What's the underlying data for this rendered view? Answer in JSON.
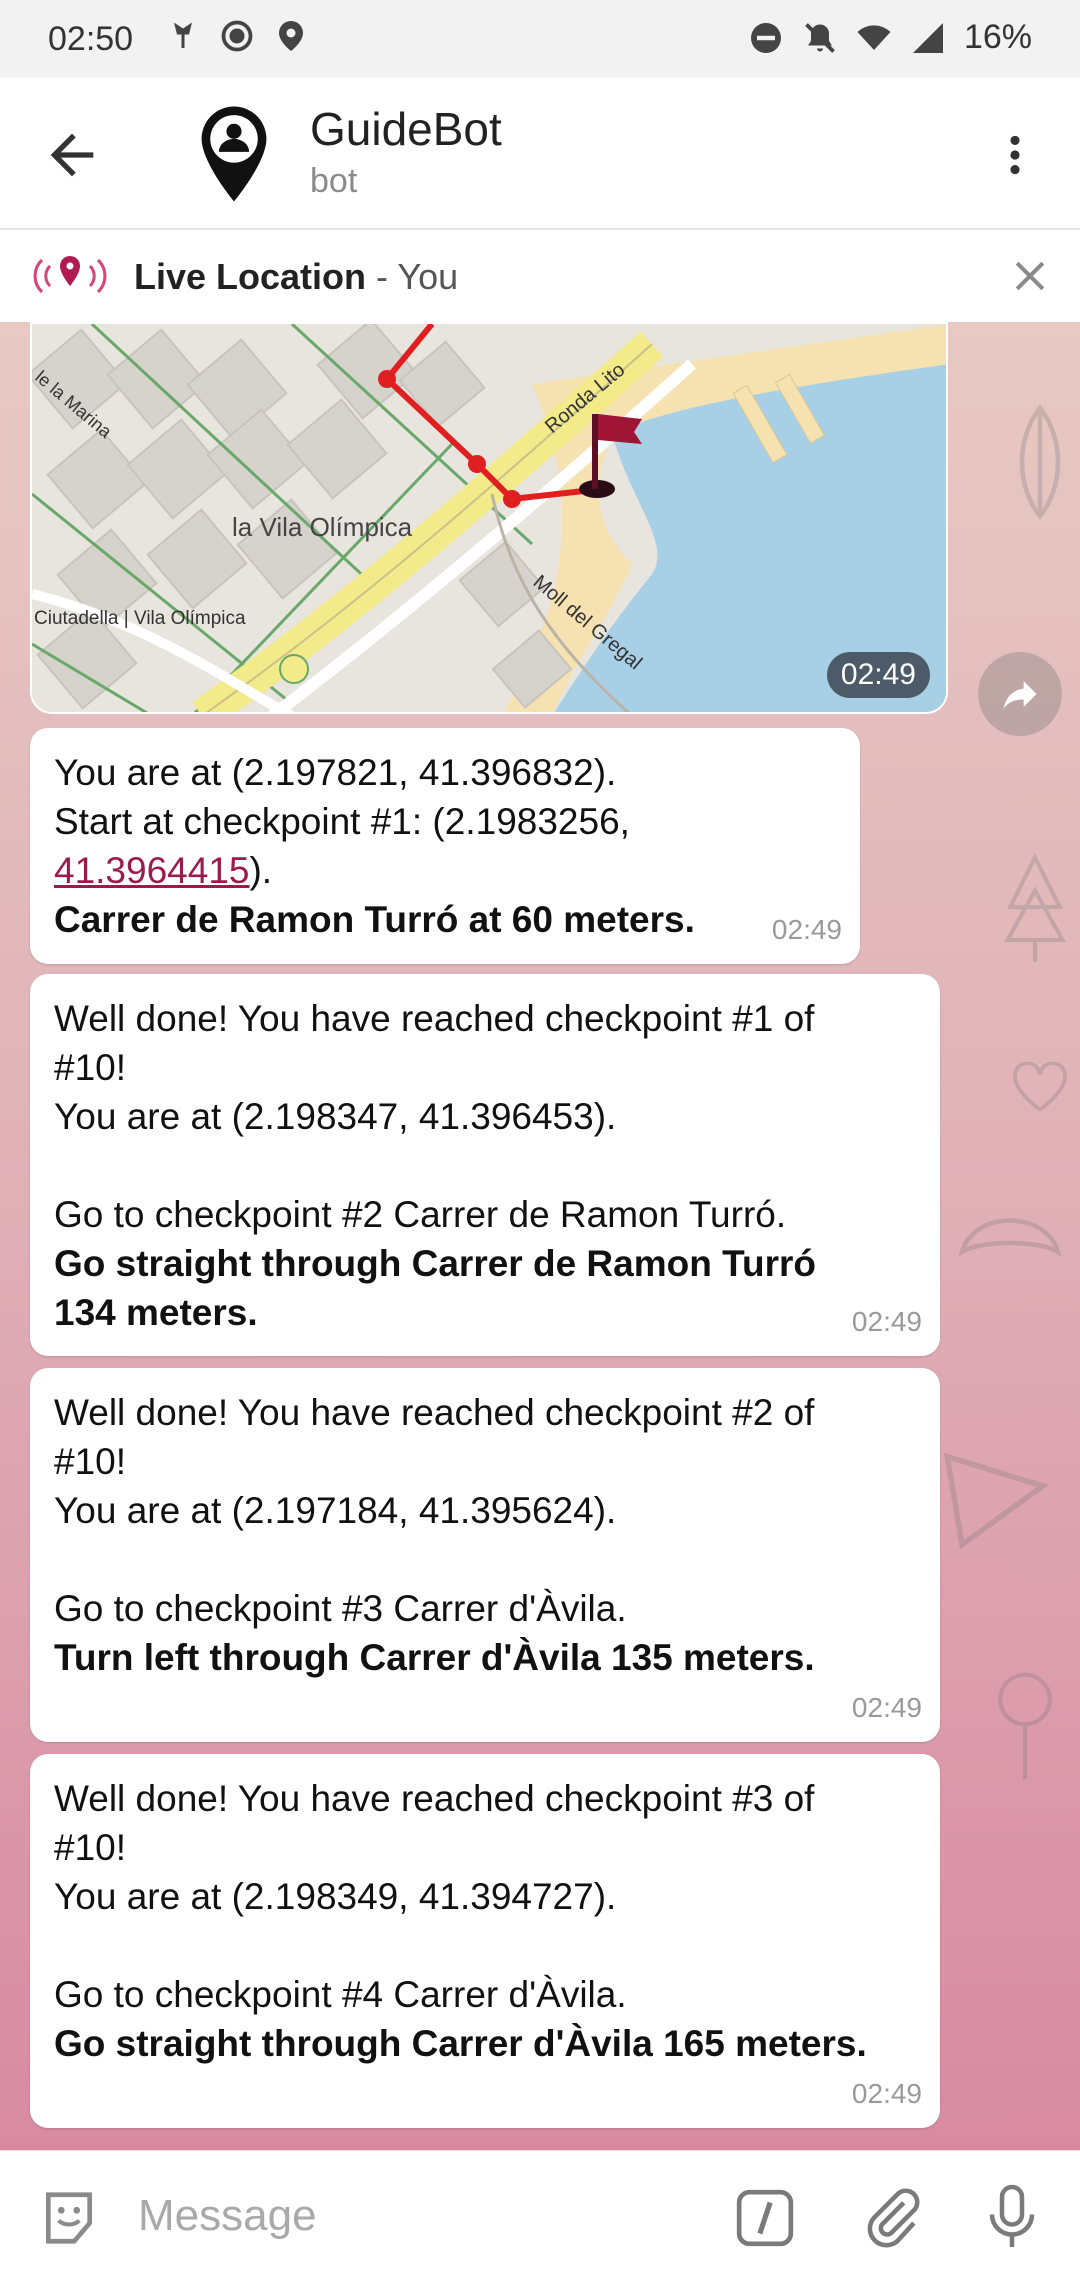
{
  "statusbar": {
    "time": "02:50",
    "battery": "16%"
  },
  "header": {
    "title": "GuideBot",
    "subtitle": "bot"
  },
  "live_location": {
    "label": "Live Location",
    "separator": " - ",
    "who": "You"
  },
  "map": {
    "time": "02:49",
    "labels": [
      "la Vila Olímpica",
      "Ciutadella | Vila Olímpica",
      "Ronda Lito",
      "Moll del Gregal",
      "le la Marina"
    ]
  },
  "messages": [
    {
      "lines": [
        {
          "text": "You are at (2.197821, 41.396832).",
          "bold": false
        },
        {
          "text": "Start at checkpoint #1: (2.1983256,",
          "bold": false
        },
        {
          "link": "41.3964415",
          "after": ").",
          "bold": false
        },
        {
          "text": "Carrer de Ramon Turró at 60 meters.",
          "bold": true
        }
      ],
      "time": "02:49"
    },
    {
      "lines": [
        {
          "text": "Well done! You have reached checkpoint #1 of",
          "bold": false
        },
        {
          "text": "#10!",
          "bold": false
        },
        {
          "text": "You are at (2.198347, 41.396453).",
          "bold": false
        },
        {
          "text": "",
          "bold": false
        },
        {
          "text": "Go to checkpoint #2 Carrer de Ramon Turró.",
          "bold": false
        },
        {
          "text": "Go straight through Carrer de Ramon Turró",
          "bold": true
        },
        {
          "text": "134 meters.",
          "bold": true
        }
      ],
      "time": "02:49"
    },
    {
      "lines": [
        {
          "text": "Well done! You have reached checkpoint #2 of",
          "bold": false
        },
        {
          "text": "#10!",
          "bold": false
        },
        {
          "text": "You are at (2.197184, 41.395624).",
          "bold": false
        },
        {
          "text": "",
          "bold": false
        },
        {
          "text": "Go to checkpoint #3 Carrer d'Àvila.",
          "bold": false
        },
        {
          "text": "Turn left through Carrer d'Àvila 135 meters.",
          "bold": true
        }
      ],
      "time": "02:49"
    },
    {
      "lines": [
        {
          "text": "Well done! You have reached checkpoint #3 of",
          "bold": false
        },
        {
          "text": "#10!",
          "bold": false
        },
        {
          "text": "You are at (2.198349, 41.394727).",
          "bold": false
        },
        {
          "text": "",
          "bold": false
        },
        {
          "text": "Go to checkpoint #4 Carrer d'Àvila.",
          "bold": false
        },
        {
          "text": "Go straight through Carrer d'Àvila 165 meters.",
          "bold": true
        }
      ],
      "time": "02:49"
    }
  ],
  "input": {
    "placeholder": "Message"
  },
  "colors": {
    "accent": "#9c1b4c",
    "route": "#e02020"
  }
}
